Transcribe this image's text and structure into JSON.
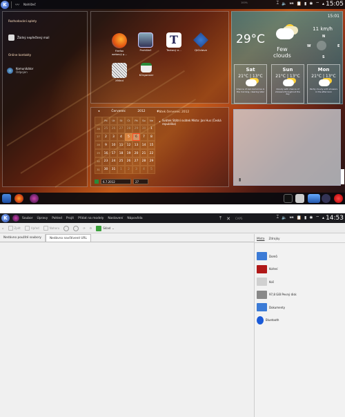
{
  "screen1": {
    "topbar": {
      "window_title": "Nahlížeč",
      "cpu": "100%",
      "kbd": "us",
      "clock": "15:05"
    },
    "left_panel": {
      "header1": "Rozhodování aplety",
      "item1": "Žádný nepřečtený mail",
      "header2": "Online kontakty",
      "contact_name": "Komunikátor",
      "contact_status": "Odpojen"
    },
    "apps": [
      {
        "label": "Firefox\nwebový p...",
        "name": "firefox"
      },
      {
        "label": "Prohlížeč",
        "name": "viewer"
      },
      {
        "label": "Textový e...",
        "name": "text-editor"
      },
      {
        "label": "QtOctave",
        "name": "qtoctave"
      },
      {
        "label": "XMind",
        "name": "xmind"
      },
      {
        "label": "KOrganizer",
        "name": "korganizer"
      }
    ],
    "weather": {
      "time": "15:01",
      "temp": "29°C",
      "condition": "Few\nclouds",
      "wind": "11 km/h",
      "compass": {
        "n": "N",
        "e": "E",
        "s": "S",
        "w": "W"
      },
      "days": [
        {
          "name": "Sat",
          "temps": "21°C | 13°C",
          "text": "Chance of rain tomorrow in the morning, clearing later"
        },
        {
          "name": "Sun",
          "temps": "21°C | 13°C",
          "text": "Cloudy with chance of showers throughout the day"
        },
        {
          "name": "Mon",
          "temps": "21°C | 13°C",
          "text": "Partly cloudy with showers in the afternoon"
        }
      ]
    },
    "calendar": {
      "month": "Červenec",
      "year": "2012",
      "headers": [
        "",
        "Po",
        "Út",
        "St",
        "Čt",
        "Pá",
        "So",
        "Ne"
      ],
      "weeks": [
        [
          "26",
          "25",
          "26",
          "27",
          "28",
          "29",
          "30",
          "1"
        ],
        [
          "27",
          "2",
          "3",
          "4",
          "5",
          "6",
          "7",
          "8"
        ],
        [
          "28",
          "9",
          "10",
          "11",
          "12",
          "13",
          "14",
          "15"
        ],
        [
          "29",
          "16",
          "17",
          "18",
          "19",
          "20",
          "21",
          "22"
        ],
        [
          "30",
          "23",
          "24",
          "25",
          "26",
          "27",
          "28",
          "29"
        ],
        [
          "31",
          "30",
          "31",
          "1",
          "2",
          "3",
          "4",
          "5"
        ]
      ],
      "date_input": "6.7.2012",
      "week_input": "27",
      "events_title": "Pátek červenec 2012",
      "event": "Svátek Státní svátek   Místo: Jan Hus (Česká republika)"
    },
    "bottombar": {}
  },
  "screen2": {
    "menu": [
      "Soubor",
      "Úpravy",
      "Pohled",
      "Projít",
      "Přidat na modely",
      "Nastavení",
      "Nápověda"
    ],
    "cpu": "CAPS",
    "kbd": "us",
    "clock": "14:53",
    "toolbar": {
      "b1": "Zpět",
      "b2": "Vpřed",
      "b3": "Nahoru",
      "zoom": "Sklad"
    },
    "tabs": [
      "Nedávno použité soubory",
      "Nedávno navštívené URL"
    ],
    "side": {
      "tab1": "Místa",
      "tab2": "Zdrojky",
      "places": [
        {
          "label": "Domů",
          "color": "#3b7bd6"
        },
        {
          "label": "Koření",
          "color": "#b01818"
        },
        {
          "label": "Koš",
          "color": "#d0d0d0"
        },
        {
          "label": "97,8 GiB Pevný disk",
          "color": "#888888"
        },
        {
          "label": "Dokumenty",
          "color": "#3b7bd6"
        },
        {
          "label": "Bluetooth",
          "color": "#1a5ad8"
        }
      ]
    }
  }
}
